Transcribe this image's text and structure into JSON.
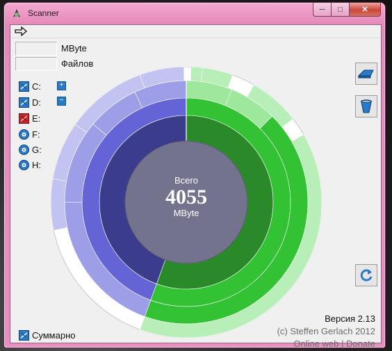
{
  "window": {
    "title": "Scanner",
    "min_glyph": "─",
    "max_glyph": "□",
    "close_glyph": "✕"
  },
  "readouts": {
    "size_value": "",
    "size_unit": "MByte",
    "files_value": "",
    "files_unit": "Файлов"
  },
  "drives": [
    {
      "label": "C:",
      "icon": "hard-drive-icon"
    },
    {
      "label": "D:",
      "icon": "hard-drive-icon"
    },
    {
      "label": "E:",
      "icon": "hard-drive-disabled-icon"
    },
    {
      "label": "F:",
      "icon": "optical-disc-icon"
    },
    {
      "label": "G:",
      "icon": "optical-disc-icon"
    },
    {
      "label": "H:",
      "icon": "optical-disc-icon"
    }
  ],
  "expand": {
    "plus": "+",
    "minus": "−"
  },
  "center": {
    "caption": "Всего",
    "total": "4055",
    "unit": "MByte"
  },
  "summary_label": "Суммарно",
  "version": "Версия 2.13",
  "copyright": "(c) Steffen Gerlach 2012",
  "links": {
    "web": "Online web",
    "separator": " | ",
    "donate": "Donate"
  },
  "colors": {
    "accent_green": "#33c233",
    "accent_blue": "#6464d6",
    "center_fill": "#73738e",
    "title_bar": "#e98fbf"
  }
}
